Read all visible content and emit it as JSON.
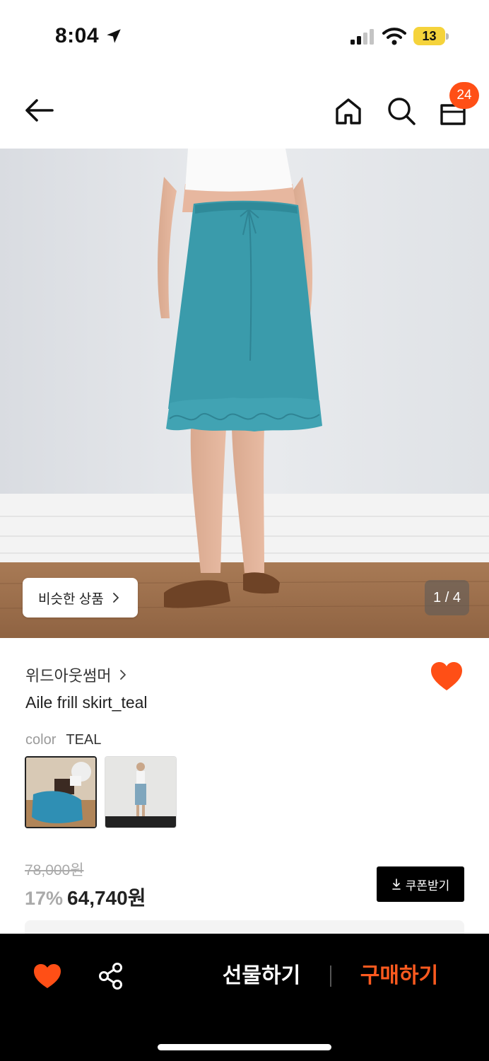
{
  "status_bar": {
    "time": "8:04",
    "battery": "13"
  },
  "header": {
    "cart_count": "24"
  },
  "hero": {
    "similar_label": "비슷한 상품",
    "page_indicator": "1 / 4"
  },
  "product": {
    "brand": "위드아웃썸머",
    "name": "Aile frill skirt_teal",
    "option_label": "color",
    "option_value": "TEAL",
    "original_price": "78,000원",
    "discount": "17%",
    "sale_price": "64,740원",
    "coupon_label": "쿠폰받기",
    "liked": true
  },
  "bottom_bar": {
    "gift_label": "선물하기",
    "buy_label": "구매하기"
  },
  "colors": {
    "accent": "#ff4f16",
    "skirt": "#3a9bab",
    "bar": "#000000"
  },
  "icons": [
    "location-arrow-icon",
    "signal-icon",
    "wifi-icon",
    "battery-icon",
    "back-arrow-icon",
    "home-icon",
    "search-icon",
    "shopping-bag-icon",
    "chevron-right-icon",
    "heart-icon",
    "download-icon",
    "share-icon"
  ]
}
